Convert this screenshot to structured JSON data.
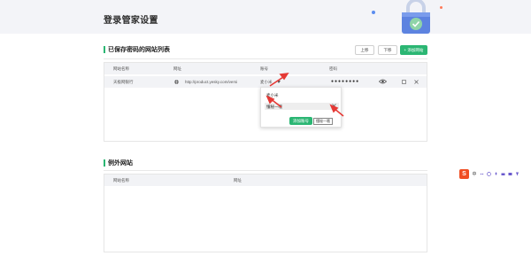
{
  "page": {
    "title": "登录管家设置"
  },
  "saved_section": {
    "title": "已保存密码的网站列表",
    "buttons": {
      "up": "上移",
      "down": "下移",
      "add_site": "+ 添加网站"
    },
    "columns": [
      "网站名称",
      "网址",
      "账号",
      "密码"
    ],
    "rows": [
      {
        "site_name": "天极网银行",
        "url": "http://product.yesky.com/versi",
        "account": "麦小米",
        "password": "●●●●●●●●"
      }
    ]
  },
  "account_dropdown": {
    "items": [
      "麦小米",
      "懂秘一哦"
    ],
    "add_button": "添加账号",
    "tooltip": "懂秘一哦"
  },
  "exception_section": {
    "title": "例外网站",
    "columns": [
      "网站名称",
      "网址"
    ]
  },
  "colors": {
    "accent_green": "#2bb673",
    "arrow_red": "#e53935",
    "header_bg": "#f3f4f8"
  },
  "icons": [
    "lock-icon",
    "globe-icon",
    "eye-icon",
    "copy-icon",
    "close-icon",
    "caret-down-icon",
    "sogou-s-icon"
  ]
}
